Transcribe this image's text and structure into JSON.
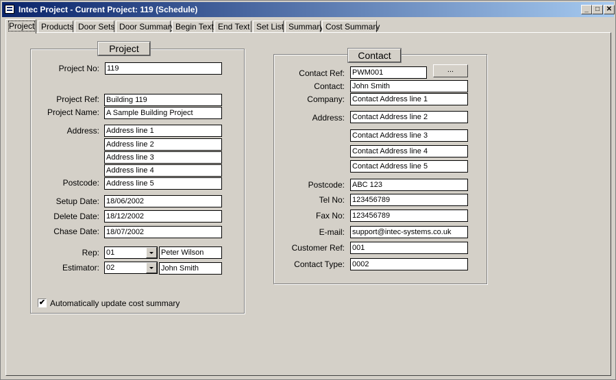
{
  "window": {
    "title": "Intec Project - Current Project: 119 (Schedule)",
    "minimize": "_",
    "maximize": "□",
    "close": "✕"
  },
  "tabs": [
    {
      "label": "Project",
      "active": true
    },
    {
      "label": "Products"
    },
    {
      "label": "Door Sets"
    },
    {
      "label": "Door Summary"
    },
    {
      "label": "Begin Text"
    },
    {
      "label": "End Text"
    },
    {
      "label": "Set List"
    },
    {
      "label": "Summary"
    },
    {
      "label": "Cost Summary"
    }
  ],
  "project": {
    "group_title": "Project",
    "project_no_label": "Project No:",
    "project_no": "119",
    "project_ref_label": "Project Ref:",
    "project_ref": "Building 119",
    "project_name_label": "Project Name:",
    "project_name": "A Sample Building Project",
    "address_label": "Address:",
    "address": [
      "Address line 1",
      "Address line 2",
      "Address line 3",
      "Address line 4"
    ],
    "postcode_label": "Postcode:",
    "postcode": "Address line 5",
    "setup_date_label": "Setup Date:",
    "setup_date": "18/06/2002",
    "delete_date_label": "Delete Date:",
    "delete_date": "18/12/2002",
    "chase_date_label": "Chase Date:",
    "chase_date": "18/07/2002",
    "rep_label": "Rep:",
    "rep_code": "01",
    "rep_name": "Peter Wilson",
    "estimator_label": "Estimator:",
    "estimator_code": "02",
    "estimator_name": "John Smith",
    "auto_update_label": "Automatically update cost summary",
    "auto_update_checked": true,
    "check_mark": "✔"
  },
  "contact": {
    "group_title": "Contact",
    "contact_ref_label": "Contact Ref:",
    "contact_ref": "PWM001",
    "lookup_button": "...",
    "contact_label": "Contact:",
    "contact": "John Smith",
    "company_label": "Company:",
    "company": "Contact Address line 1",
    "address_label": "Address:",
    "address": [
      "Contact Address line 2",
      "Contact Address line 3",
      "Contact Address line 4",
      "Contact Address line 5"
    ],
    "postcode_label": "Postcode:",
    "postcode": "ABC 123",
    "tel_label": "Tel No:",
    "tel": "123456789",
    "fax_label": "Fax No:",
    "fax": "123456789",
    "email_label": "E-mail:",
    "email": "support@intec-systems.co.uk",
    "customer_ref_label": "Customer Ref:",
    "customer_ref": "001",
    "contact_type_label": "Contact Type:",
    "contact_type": "0002"
  }
}
